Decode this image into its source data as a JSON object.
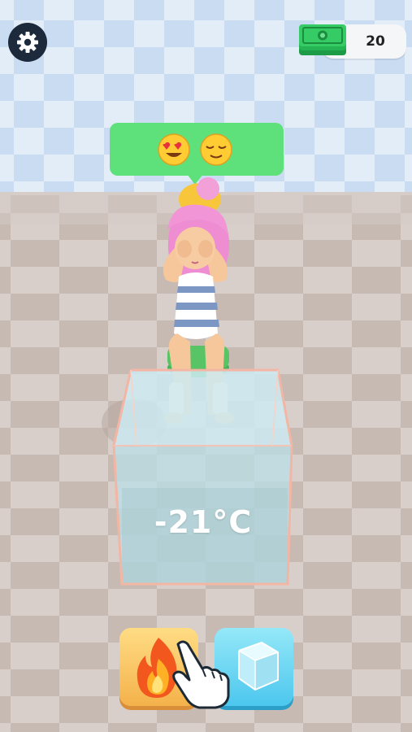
{
  "hud": {
    "settings_icon": "gear-icon",
    "money_icon": "cash-bundle-icon",
    "money_amount": "20"
  },
  "bubble": {
    "emojis": [
      "heart-eyes-emoji",
      "relieved-face-emoji"
    ]
  },
  "cube": {
    "temperature": "-21°C"
  },
  "controls": {
    "heat_icon": "fire-icon",
    "cool_icon": "ice-cube-icon",
    "tutorial_icon": "pointing-hand-icon"
  },
  "colors": {
    "bubble": "#5ee07a",
    "heat_button": "#f4b24b",
    "ice_button": "#4cc7ee",
    "settings_button": "#1c2a3c"
  }
}
